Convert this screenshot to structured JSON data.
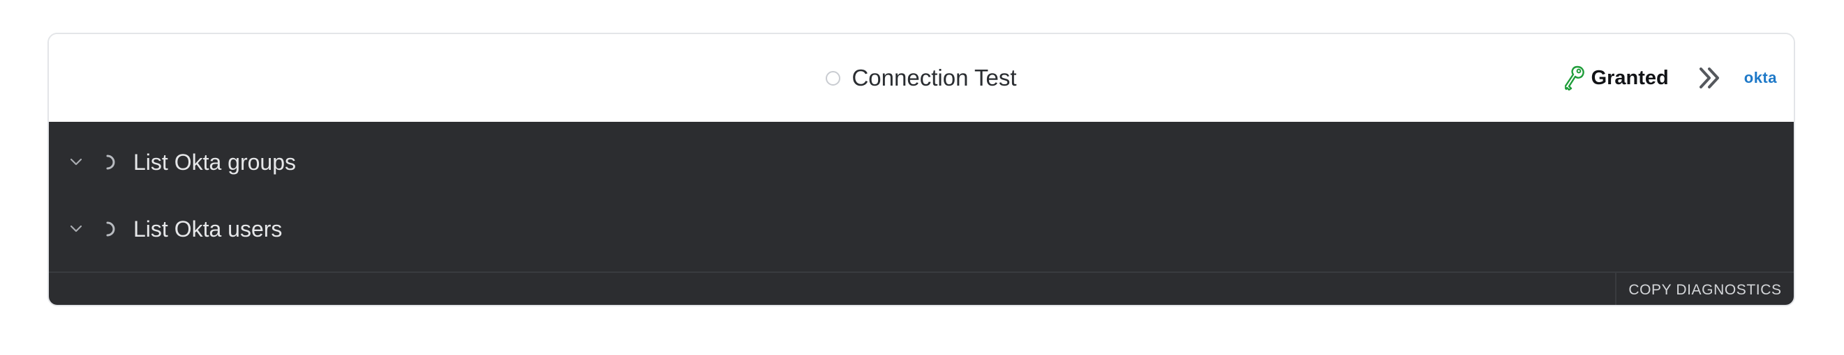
{
  "header": {
    "title": "Connection Test",
    "status_icon": "empty-circle-icon",
    "access": {
      "icon": "key-icon",
      "label": "Granted",
      "color": "#1f9d3a"
    },
    "expand_icon": "double-chevron-right-icon",
    "logo_text": "okta",
    "logo_color": "#1e79c8"
  },
  "steps": [
    {
      "label": "List Okta groups",
      "icon": "chevron-down-icon",
      "status_icon": "spinner-icon"
    },
    {
      "label": "List Okta users",
      "icon": "chevron-down-icon",
      "status_icon": "spinner-icon"
    }
  ],
  "footer": {
    "copy_label": "COPY DIAGNOSTICS"
  },
  "colors": {
    "panel_bg": "#2c2d30",
    "header_bg": "#ffffff"
  }
}
